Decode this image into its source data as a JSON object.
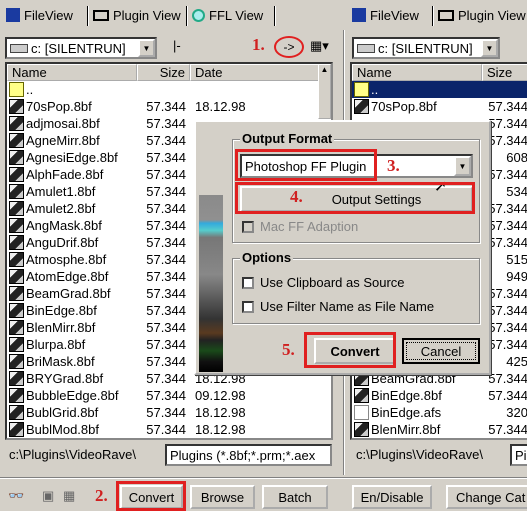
{
  "left": {
    "tabs": [
      {
        "label": "FileView",
        "icon": "floppy-icon"
      },
      {
        "label": "Plugin View",
        "icon": "plugin-icon"
      },
      {
        "label": "FFL View",
        "icon": "magnifier-icon"
      }
    ],
    "drive": "c: [SILENTRUN]",
    "toolbar_marker": "|-",
    "arrow_label": "->",
    "columns": [
      "Name",
      "Size",
      "Date"
    ],
    "rows": [
      {
        "name": "..",
        "size": "",
        "date": "",
        "type": "folder"
      },
      {
        "name": "70sPop.8bf",
        "size": "57.344",
        "date": "18.12.98"
      },
      {
        "name": "adjmosai.8bf",
        "size": "57.344",
        "date": ""
      },
      {
        "name": "AgneMirr.8bf",
        "size": "57.344",
        "date": ""
      },
      {
        "name": "AgnesiEdge.8bf",
        "size": "57.344",
        "date": ""
      },
      {
        "name": "AlphFade.8bf",
        "size": "57.344",
        "date": ""
      },
      {
        "name": "Amulet1.8bf",
        "size": "57.344",
        "date": ""
      },
      {
        "name": "Amulet2.8bf",
        "size": "57.344",
        "date": ""
      },
      {
        "name": "AngMask.8bf",
        "size": "57.344",
        "date": ""
      },
      {
        "name": "AnguDrif.8bf",
        "size": "57.344",
        "date": ""
      },
      {
        "name": "Atmosphe.8bf",
        "size": "57.344",
        "date": ""
      },
      {
        "name": "AtomEdge.8bf",
        "size": "57.344",
        "date": ""
      },
      {
        "name": "BeamGrad.8bf",
        "size": "57.344",
        "date": ""
      },
      {
        "name": "BinEdge.8bf",
        "size": "57.344",
        "date": ""
      },
      {
        "name": "BlenMirr.8bf",
        "size": "57.344",
        "date": ""
      },
      {
        "name": "Blurpa.8bf",
        "size": "57.344",
        "date": ""
      },
      {
        "name": "BriMask.8bf",
        "size": "57.344",
        "date": ""
      },
      {
        "name": "BRYGrad.8bf",
        "size": "57.344",
        "date": "18.12.98"
      },
      {
        "name": "BubbleEdge.8bf",
        "size": "57.344",
        "date": "09.12.98"
      },
      {
        "name": "BublGrid.8bf",
        "size": "57.344",
        "date": "18.12.98"
      },
      {
        "name": "BublMod.8bf",
        "size": "57.344",
        "date": "18.12.98"
      }
    ],
    "path": "c:\\Plugins\\VideoRave\\",
    "filter": "Plugins (*.8bf;*.prm;*.aex"
  },
  "right": {
    "tabs": [
      {
        "label": "FileView",
        "icon": "floppy-icon"
      },
      {
        "label": "Plugin View",
        "icon": "plugin-icon"
      }
    ],
    "drive": "c: [SILENTRUN]",
    "columns": [
      "Name",
      "Size"
    ],
    "rows": [
      {
        "name": "..",
        "size": "",
        "type": "folder",
        "selected": true
      },
      {
        "name": "70sPop.8bf",
        "size": "57.344"
      },
      {
        "name": "",
        "size": "57.344"
      },
      {
        "name": "",
        "size": "57.344"
      },
      {
        "name": "",
        "size": "608"
      },
      {
        "name": "",
        "size": "57.344"
      },
      {
        "name": "",
        "size": "534"
      },
      {
        "name": "",
        "size": "57.344"
      },
      {
        "name": "",
        "size": "57.344"
      },
      {
        "name": "",
        "size": "57.344"
      },
      {
        "name": "",
        "size": "515"
      },
      {
        "name": "",
        "size": "949"
      },
      {
        "name": "",
        "size": "57.344"
      },
      {
        "name": "",
        "size": "57.344"
      },
      {
        "name": "",
        "size": "57.344"
      },
      {
        "name": "",
        "size": "57.344"
      },
      {
        "name": "",
        "size": "425"
      },
      {
        "name": "BeamGrad.8bf",
        "size": "57.344"
      },
      {
        "name": "BinEdge.8bf",
        "size": "57.344"
      },
      {
        "name": "BinEdge.afs",
        "size": "320",
        "type": "doc"
      },
      {
        "name": "BlenMirr.8bf",
        "size": "57.344"
      }
    ],
    "path": "c:\\Plugins\\VideoRave\\",
    "filter": "Pi"
  },
  "dialog": {
    "output_format_label": "Output Format",
    "format_value": "Photoshop FF Plugin",
    "output_settings": "Output Settings",
    "mac_ff": "Mac FF Adaption",
    "options_label": "Options",
    "opt_clipboard": "Use Clipboard as Source",
    "opt_filtername": "Use Filter Name as File Name",
    "convert": "Convert",
    "cancel": "Cancel"
  },
  "bottom": {
    "convert": "Convert",
    "browse": "Browse",
    "batch": "Batch",
    "endisable": "En/Disable",
    "changecat": "Change Cat"
  },
  "annotations": {
    "a1": "1.",
    "a2": "2.",
    "a3": "3.",
    "a4": "4.",
    "a5": "5."
  },
  "colors": {
    "annotation": "#e02020",
    "selection": "#0a246a"
  }
}
